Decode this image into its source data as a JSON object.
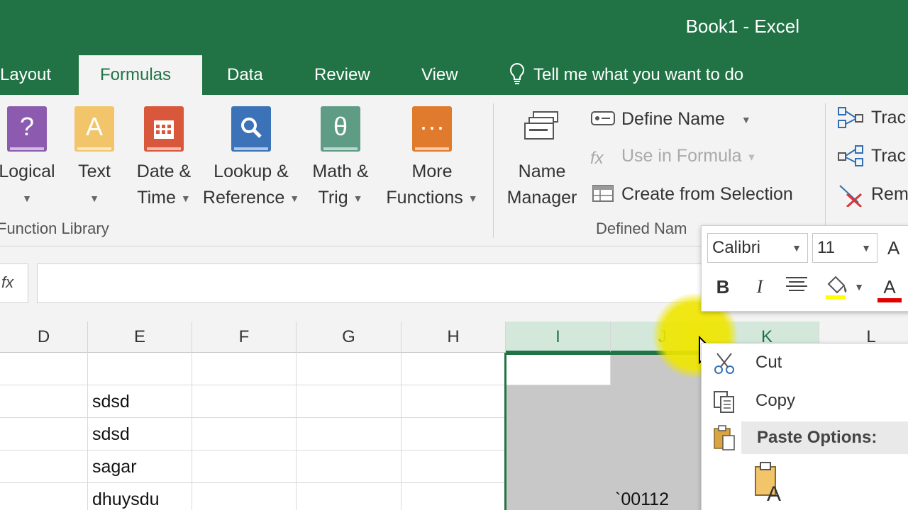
{
  "window": {
    "title": "Book1 - Excel"
  },
  "tabs": [
    {
      "label": "Layout",
      "active": false
    },
    {
      "label": "Formulas",
      "active": true
    },
    {
      "label": "Data",
      "active": false
    },
    {
      "label": "Review",
      "active": false
    },
    {
      "label": "View",
      "active": false
    }
  ],
  "tell_me": {
    "placeholder": "Tell me what you want to do",
    "icon": "lightbulb-icon"
  },
  "ribbon": {
    "function_library": {
      "label": "Function Library",
      "buttons": [
        {
          "line1": "Logical",
          "line2": "",
          "icon": "logical-icon",
          "color": "#8c5bb0"
        },
        {
          "line1": "Text",
          "line2": "",
          "icon": "text-icon",
          "color": "#e9b44c"
        },
        {
          "line1": "Date &",
          "line2": "Time",
          "icon": "date-time-icon",
          "color": "#d9583c"
        },
        {
          "line1": "Lookup &",
          "line2": "Reference",
          "icon": "lookup-reference-icon",
          "color": "#3b72b8"
        },
        {
          "line1": "Math &",
          "line2": "Trig",
          "icon": "math-trig-icon",
          "color": "#5e9c85"
        },
        {
          "line1": "More",
          "line2": "Functions",
          "icon": "more-functions-icon",
          "color": "#e07b2e"
        }
      ]
    },
    "defined_names": {
      "label": "Defined Nam",
      "name_manager": {
        "line1": "Name",
        "line2": "Manager"
      },
      "define_name": "Define Name",
      "use_in_formula": "Use in Formula",
      "create_from_selection": "Create from Selection"
    },
    "formula_auditing": {
      "trace_precedents": "Trac",
      "trace_dependents": "Trac",
      "remove_arrows": "Rem"
    }
  },
  "formula_bar": {
    "fx": "fx",
    "value": ""
  },
  "columns": [
    {
      "label": "D",
      "selected": false
    },
    {
      "label": "E",
      "selected": false
    },
    {
      "label": "F",
      "selected": false
    },
    {
      "label": "G",
      "selected": false
    },
    {
      "label": "H",
      "selected": false
    },
    {
      "label": "I",
      "selected": true
    },
    {
      "label": "J",
      "selected": true
    },
    {
      "label": "K",
      "selected": true
    },
    {
      "label": "L",
      "selected": false
    }
  ],
  "cells": {
    "E2": "sdsd",
    "E3": "sdsd",
    "E4": "sagar",
    "E5": "dhuysdu",
    "J5": "`00112"
  },
  "mini_toolbar": {
    "font": "Calibri",
    "size": "11",
    "bold": "B",
    "italic": "I",
    "font_color_letter": "A",
    "grow_font_letter": "A"
  },
  "context_menu": {
    "cut": "Cut",
    "copy": "Copy",
    "paste_options": "Paste Options:"
  }
}
